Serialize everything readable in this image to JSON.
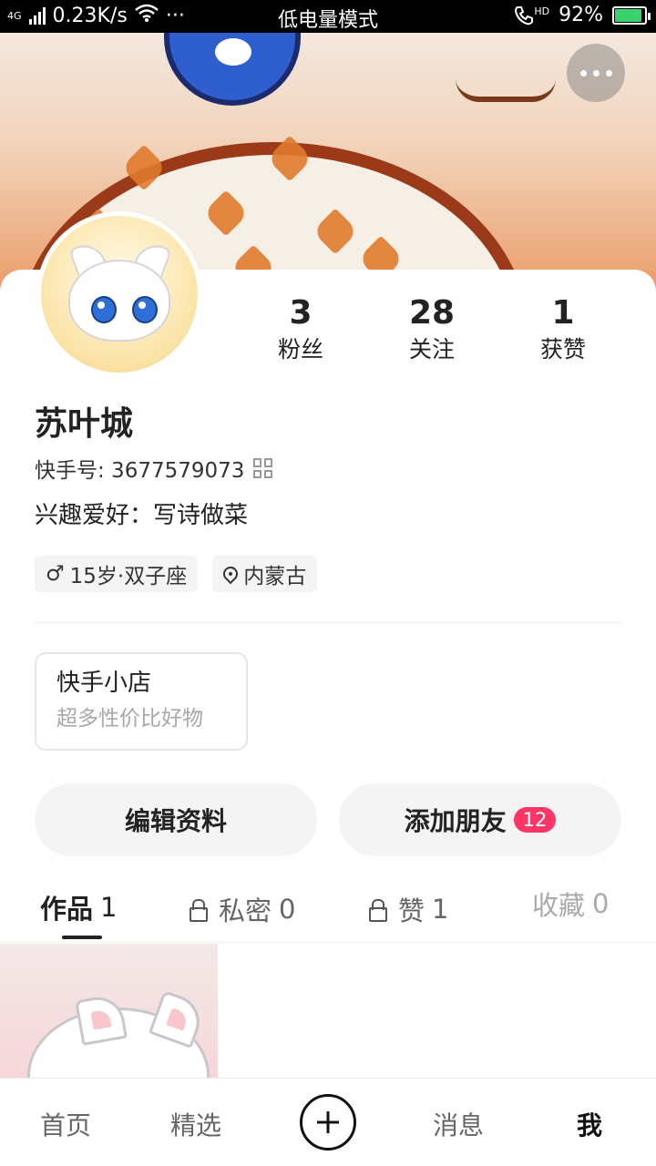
{
  "status_bar": {
    "network_type": "4G",
    "speed": "0.23K/s",
    "more": "···",
    "mode": "低电量模式",
    "call_hd": "HD",
    "battery_percent": "92%",
    "battery_level": 0.92,
    "battery_color": "#3bd16f"
  },
  "header": {
    "more_icon": "more-dots-icon"
  },
  "stats": [
    {
      "value": "3",
      "label": "粉丝"
    },
    {
      "value": "28",
      "label": "关注"
    },
    {
      "value": "1",
      "label": "获赞"
    }
  ],
  "profile": {
    "name": "苏叶城",
    "kuaishou_id": "快手号: 3677579073",
    "hobby": "兴趣爱好：写诗做菜",
    "age_tag": "15岁·双子座",
    "gender_symbol": "♂",
    "location_tag": "内蒙古"
  },
  "shop": {
    "title": "快手小店",
    "subtitle": "超多性价比好物"
  },
  "actions": {
    "edit_label": "编辑资料",
    "add_friend_label": "添加朋友",
    "add_friend_badge": "12",
    "badge_color": "#fe3666"
  },
  "tabs": [
    {
      "label": "作品",
      "count": "1",
      "active": true,
      "locked": false
    },
    {
      "label": "私密",
      "count": "0",
      "active": false,
      "locked": true
    },
    {
      "label": "赞",
      "count": "1",
      "active": false,
      "locked": true
    },
    {
      "label": "收藏",
      "count": "0",
      "active": false,
      "locked": false
    }
  ],
  "bottom_nav": {
    "home": "首页",
    "featured": "精选",
    "messages": "消息",
    "me": "我"
  }
}
